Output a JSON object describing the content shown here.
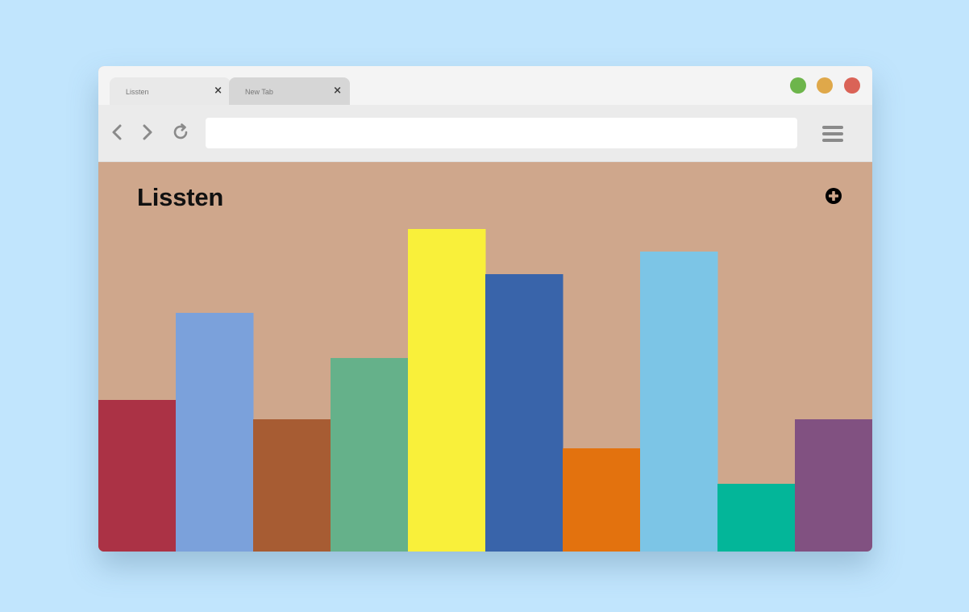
{
  "window": {
    "controls": [
      {
        "name": "green-light",
        "color": "#6db54b"
      },
      {
        "name": "yellow-light",
        "color": "#dfa84a"
      },
      {
        "name": "red-light",
        "color": "#da6357"
      }
    ]
  },
  "tabs": [
    {
      "label": "Lissten",
      "active": true
    },
    {
      "label": "New Tab",
      "active": false
    }
  ],
  "toolbar": {
    "url": ""
  },
  "page": {
    "title": "Lissten",
    "background": "#cfa78c"
  },
  "chart_data": {
    "type": "bar",
    "ylim": [
      0,
      100
    ],
    "grid": false,
    "values": [
      47,
      74,
      41,
      60,
      100,
      86,
      32,
      93,
      21,
      41
    ],
    "colors": [
      "#ab3245",
      "#7ba1db",
      "#a75c33",
      "#65b18a",
      "#f9f03a",
      "#3964aa",
      "#e3720e",
      "#7cc5e6",
      "#03b699",
      "#815181"
    ]
  }
}
